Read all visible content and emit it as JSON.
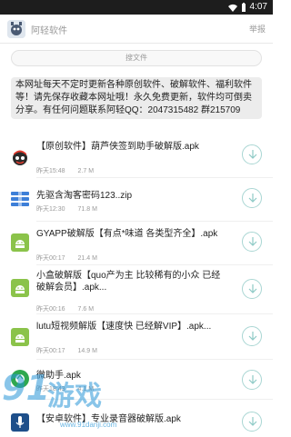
{
  "status_bar": {
    "time": "4:07",
    "icons": [
      "wifi-icon",
      "battery-icon"
    ]
  },
  "app_bar": {
    "title": "阿轻软件",
    "action": "举报",
    "logo": "app-logo"
  },
  "search": {
    "placeholder": "搜文件"
  },
  "notice": {
    "text": "本网址每天不定时更新各种原创软件、破解软件、福利软件等！请先保存收藏本网址哦！永久免费更新，软件均可倒卖分享。有任何问题联系阿轻QQ：2047315482 群215709"
  },
  "files": [
    {
      "title": "【原创软件】葫芦侠签到助手破解版.apk",
      "time": "昨天15:48",
      "size": "2.7 M",
      "icon": "avatar-icon"
    },
    {
      "title": "先驱含淘客密码123..zip",
      "time": "昨天12:30",
      "size": "71.8 M",
      "icon": "zip-icon"
    },
    {
      "title": "GYAPP破解版【有点*味道 各类型齐全】.apk",
      "time": "昨天00:17",
      "size": "21.4 M",
      "icon": "android-icon"
    },
    {
      "title": "小盒破解版【quo产为主 比较稀有的小众 已经破解会员】.apk...",
      "time": "昨天00:16",
      "size": "7.6 M",
      "icon": "android-icon"
    },
    {
      "title": "lutu短视频解版【速度快 已经解VIP】.apk...",
      "time": "昨天00:17",
      "size": "14.9 M",
      "icon": "android-icon"
    },
    {
      "title": "微助手.apk",
      "time": "昨天18:43",
      "size": "4.1 M",
      "icon": "wechat-icon"
    },
    {
      "title": "【安卓软件】专业录音器破解版.apk",
      "time": "",
      "size": "",
      "icon": "mic-icon"
    }
  ],
  "watermark": {
    "logo": "91",
    "text": "游戏",
    "url": "www.91danji.com"
  },
  "colors": {
    "accent": "#a9d6d3",
    "status_bar": "#1d1d1d",
    "notice_bg": "#ececec"
  }
}
